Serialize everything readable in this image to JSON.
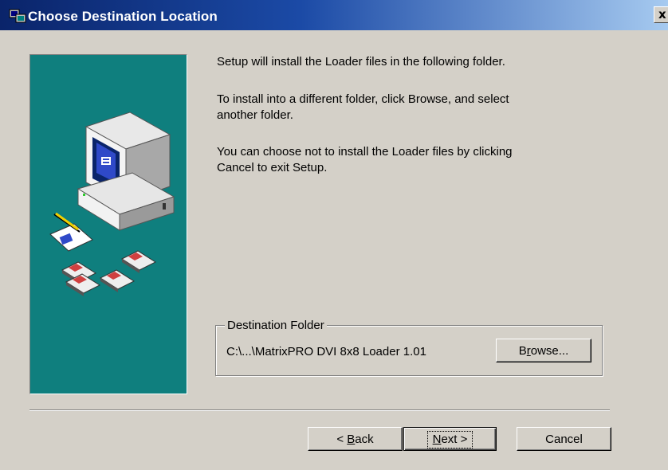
{
  "window": {
    "title": "Choose Destination Location",
    "close_glyph": "x"
  },
  "messages": {
    "line1": "Setup will install the Loader files in the following folder.",
    "line2a": "To install into a different folder, click Browse, and select",
    "line2b": "another folder.",
    "line3a": "You can choose not to install the Loader files by clicking",
    "line3b": "Cancel to exit Setup."
  },
  "destination": {
    "legend": "Destination Folder",
    "path": "C:\\...\\MatrixPRO DVI 8x8 Loader 1.01",
    "browse_label_pre": "B",
    "browse_label_u": "r",
    "browse_label_post": "owse..."
  },
  "buttons": {
    "back_pre": "< ",
    "back_u": "B",
    "back_post": "ack",
    "next_u": "N",
    "next_post": "ext >",
    "cancel": "Cancel"
  },
  "icons": {
    "app": "setup-app-icon",
    "illustration": "computer-with-floppy-disks-illustration",
    "close": "close-icon"
  },
  "colors": {
    "titlebar_start": "#0a246a",
    "titlebar_end": "#a6caf0",
    "dialog_bg": "#d4d0c8",
    "art_panel_bg": "#0f7f7e"
  }
}
